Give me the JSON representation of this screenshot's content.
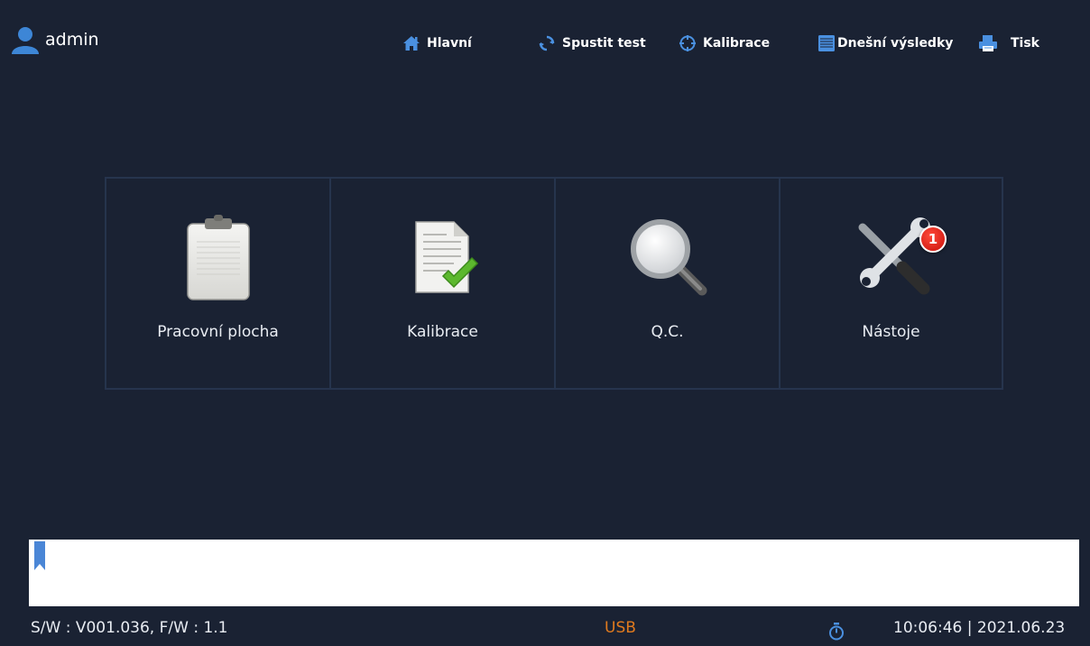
{
  "user": {
    "name": "admin",
    "icon": "user-icon"
  },
  "nav": [
    {
      "label": "Hlavní",
      "icon": "home-icon"
    },
    {
      "label": "Spustit test",
      "icon": "refresh-icon"
    },
    {
      "label": "Kalibrace",
      "icon": "crosshair-icon"
    },
    {
      "label": "Dnešní výsledky",
      "icon": "list-icon"
    },
    {
      "label": "Tisk",
      "icon": "printer-icon"
    }
  ],
  "tiles": [
    {
      "label": "Pracovní plocha",
      "icon": "clipboard-icon"
    },
    {
      "label": "Kalibrace",
      "icon": "document-check-icon"
    },
    {
      "label": "Q.C.",
      "icon": "magnifier-icon"
    },
    {
      "label": "Nástoje",
      "icon": "tools-icon",
      "badge": "1"
    }
  ],
  "status": {
    "version": "S/W : V001.036, F/W : 1.1",
    "usb": "USB",
    "datetime": "10:06:46 | 2021.06.23"
  },
  "colors": {
    "background": "#1a2233",
    "grid_line": "#26344d",
    "accent_blue": "#3d86d6",
    "usb": "#e07a1e",
    "badge": "#d8170f"
  }
}
